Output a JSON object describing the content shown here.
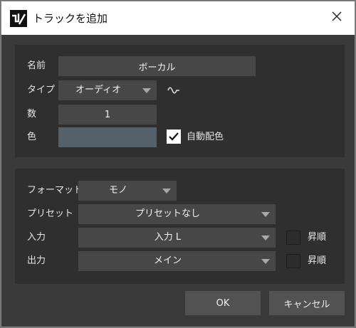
{
  "window": {
    "title": "トラックを追加",
    "icons": {
      "app": "app-logo-icon",
      "close": "close-icon"
    }
  },
  "track": {
    "name_label": "名前",
    "name_value": "ボーカル",
    "type_label": "タイプ",
    "type_value": "オーディオ",
    "type_icon": "audio-waveform-icon",
    "count_label": "数",
    "count_value": "1",
    "color_label": "色",
    "color_value": "#54606a",
    "auto_color_label": "自動配色",
    "auto_color_checked": true
  },
  "io": {
    "format_label": "フォーマット",
    "format_value": "モノ",
    "preset_label": "プリセット",
    "preset_value": "プリセットなし",
    "input_label": "入力",
    "input_value": "入力 L",
    "input_ascending_label": "昇順",
    "input_ascending_checked": false,
    "output_label": "出力",
    "output_value": "メイン",
    "output_ascending_label": "昇順",
    "output_ascending_checked": false
  },
  "buttons": {
    "ok": "OK",
    "cancel": "キャンセル"
  }
}
